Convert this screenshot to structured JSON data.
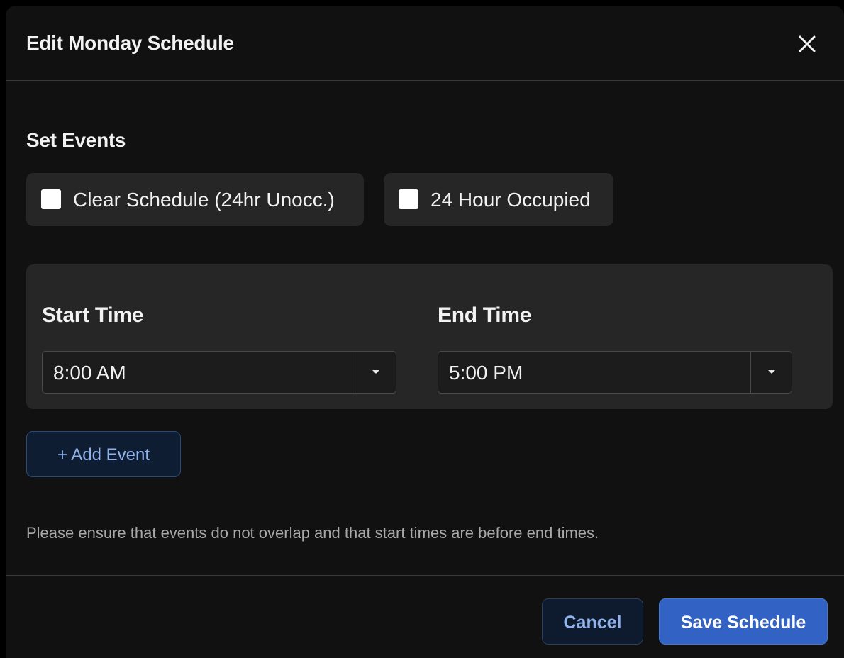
{
  "dialog": {
    "title": "Edit Monday Schedule",
    "close_icon": "close-icon"
  },
  "set_events": {
    "heading": "Set Events",
    "options": [
      {
        "label": "Clear Schedule (24hr Unocc.)",
        "checked": false
      },
      {
        "label": "24 Hour Occupied",
        "checked": false
      }
    ]
  },
  "event": {
    "start_label": "Start Time",
    "start_value": "8:00 AM",
    "end_label": "End Time",
    "end_value": "5:00 PM",
    "dropdown_icon": "caret-down-icon"
  },
  "add_event": {
    "label": "+ Add Event"
  },
  "hint": "Please ensure that events do not overlap and that start times are before end times.",
  "footer": {
    "cancel_label": "Cancel",
    "save_label": "Save Schedule"
  },
  "colors": {
    "modal_bg": "#111111",
    "card_bg": "#262626",
    "accent_blue": "#3263c4",
    "link_blue": "#8fb3ea"
  }
}
